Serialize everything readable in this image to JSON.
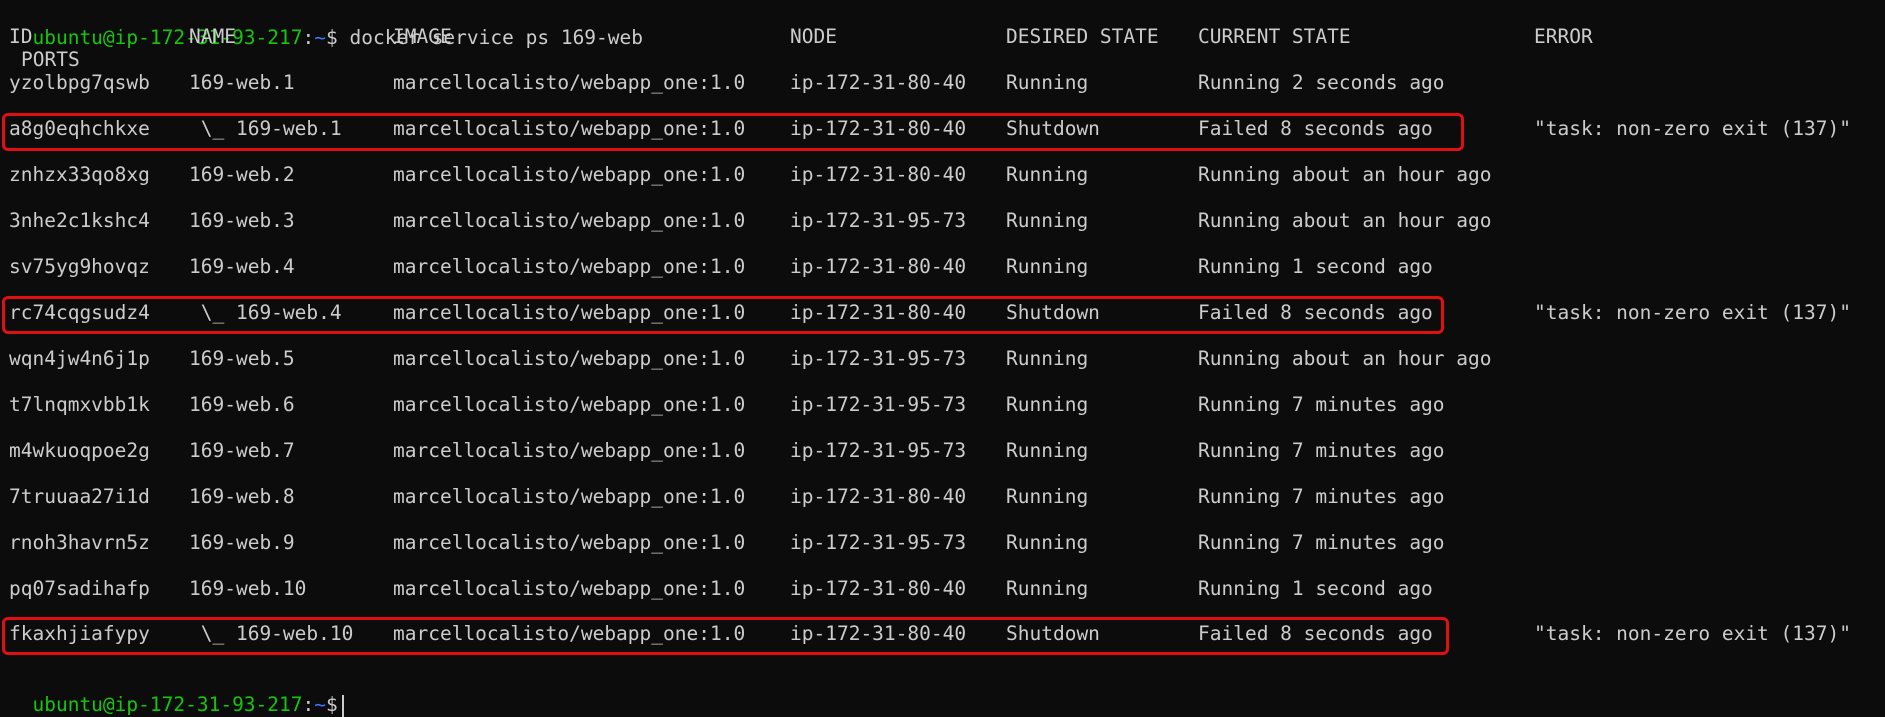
{
  "prompt": {
    "user_host": "ubuntu@ip-172-31-93-217",
    "sep": ":",
    "path": "~",
    "symbol": "$",
    "command": " docker service ps 169-web"
  },
  "headers": {
    "id": "ID",
    "name": "NAME",
    "image": "IMAGE",
    "node": "NODE",
    "desired": "DESIRED STATE",
    "current": "CURRENT STATE",
    "error": "ERROR",
    "ports": "PORTS"
  },
  "rows": [
    {
      "id": "yzolbpg7qswb",
      "name": "169-web.1",
      "image": "marcellocalisto/webapp_one:1.0",
      "node": "ip-172-31-80-40",
      "desired": "Running",
      "current": "Running 2 seconds ago",
      "error": ""
    },
    {
      "id": "a8g0eqhchkxe",
      "name": " \\_ 169-web.1",
      "image": "marcellocalisto/webapp_one:1.0",
      "node": "ip-172-31-80-40",
      "desired": "Shutdown",
      "current": "Failed 8 seconds ago",
      "error": "\"task: non-zero exit (137)\""
    },
    {
      "id": "znhzx33qo8xg",
      "name": "169-web.2",
      "image": "marcellocalisto/webapp_one:1.0",
      "node": "ip-172-31-80-40",
      "desired": "Running",
      "current": "Running about an hour ago",
      "error": ""
    },
    {
      "id": "3nhe2c1kshc4",
      "name": "169-web.3",
      "image": "marcellocalisto/webapp_one:1.0",
      "node": "ip-172-31-95-73",
      "desired": "Running",
      "current": "Running about an hour ago",
      "error": ""
    },
    {
      "id": "sv75yg9hovqz",
      "name": "169-web.4",
      "image": "marcellocalisto/webapp_one:1.0",
      "node": "ip-172-31-80-40",
      "desired": "Running",
      "current": "Running 1 second ago",
      "error": ""
    },
    {
      "id": "rc74cqgsudz4",
      "name": " \\_ 169-web.4",
      "image": "marcellocalisto/webapp_one:1.0",
      "node": "ip-172-31-80-40",
      "desired": "Shutdown",
      "current": "Failed 8 seconds ago",
      "error": "\"task: non-zero exit (137)\""
    },
    {
      "id": "wqn4jw4n6j1p",
      "name": "169-web.5",
      "image": "marcellocalisto/webapp_one:1.0",
      "node": "ip-172-31-95-73",
      "desired": "Running",
      "current": "Running about an hour ago",
      "error": ""
    },
    {
      "id": "t7lnqmxvbb1k",
      "name": "169-web.6",
      "image": "marcellocalisto/webapp_one:1.0",
      "node": "ip-172-31-95-73",
      "desired": "Running",
      "current": "Running 7 minutes ago",
      "error": ""
    },
    {
      "id": "m4wkuoqpoe2g",
      "name": "169-web.7",
      "image": "marcellocalisto/webapp_one:1.0",
      "node": "ip-172-31-95-73",
      "desired": "Running",
      "current": "Running 7 minutes ago",
      "error": ""
    },
    {
      "id": "7truuaa27i1d",
      "name": "169-web.8",
      "image": "marcellocalisto/webapp_one:1.0",
      "node": "ip-172-31-80-40",
      "desired": "Running",
      "current": "Running 7 minutes ago",
      "error": ""
    },
    {
      "id": "rnoh3havrn5z",
      "name": "169-web.9",
      "image": "marcellocalisto/webapp_one:1.0",
      "node": "ip-172-31-95-73",
      "desired": "Running",
      "current": "Running 7 minutes ago",
      "error": ""
    },
    {
      "id": "pq07sadihafp",
      "name": "169-web.10",
      "image": "marcellocalisto/webapp_one:1.0",
      "node": "ip-172-31-80-40",
      "desired": "Running",
      "current": "Running 1 second ago",
      "error": ""
    },
    {
      "id": "fkaxhjiafypy",
      "name": " \\_ 169-web.10",
      "image": "marcellocalisto/webapp_one:1.0",
      "node": "ip-172-31-80-40",
      "desired": "Shutdown",
      "current": "Failed 8 seconds ago",
      "error": "\"task: non-zero exit (137)\""
    }
  ],
  "highlighted_rows": [
    1,
    5,
    12
  ],
  "colors": {
    "background": "#0c0c0c",
    "text": "#cccccc",
    "prompt_user": "#16c60c",
    "prompt_path": "#3b78ff",
    "highlight_border": "#e01010"
  }
}
